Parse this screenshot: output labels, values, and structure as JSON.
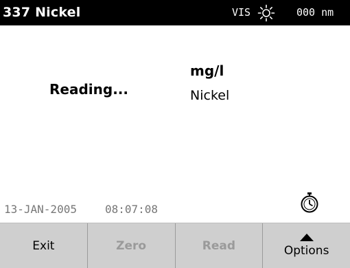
{
  "header": {
    "title": "337 Nickel",
    "mode": "VIS",
    "lamp_icon": "lamp-on-icon",
    "wavelength": "000 nm"
  },
  "main": {
    "status": "Reading...",
    "units": "mg/l",
    "parameter": "Nickel"
  },
  "footer": {
    "date": "13-JAN-2005",
    "time": "08:07:08",
    "timer_icon": "timer-icon"
  },
  "softkeys": {
    "exit": "Exit",
    "zero": "Zero",
    "read": "Read",
    "options": "Options"
  },
  "colors": {
    "title_bg": "#000000",
    "softkey_bg": "#cfcfcf",
    "disabled_text": "#9a9a9a"
  }
}
